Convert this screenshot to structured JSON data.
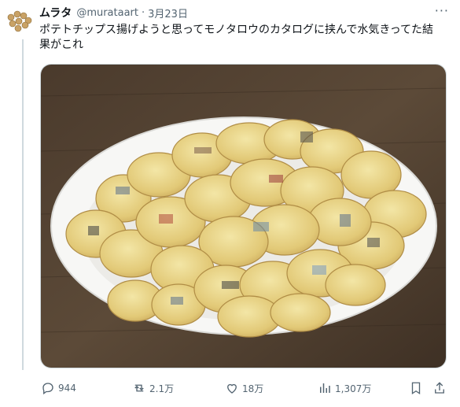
{
  "tweet": {
    "author_name": "ムラタ",
    "author_handle": "@murataart",
    "separator": "·",
    "date": "3月23日",
    "text": "ポテトチップス揚げようと思ってモノタロウのカタログに挟んで水気きってた結果がこれ",
    "more_glyph": "···"
  },
  "actions": {
    "replies": "944",
    "retweets": "2.1万",
    "likes": "18万",
    "views": "1,307万"
  },
  "icons": [
    "avatar-icon",
    "more-icon",
    "reply-icon",
    "retweet-icon",
    "like-icon",
    "views-icon",
    "bookmark-icon",
    "share-icon"
  ]
}
